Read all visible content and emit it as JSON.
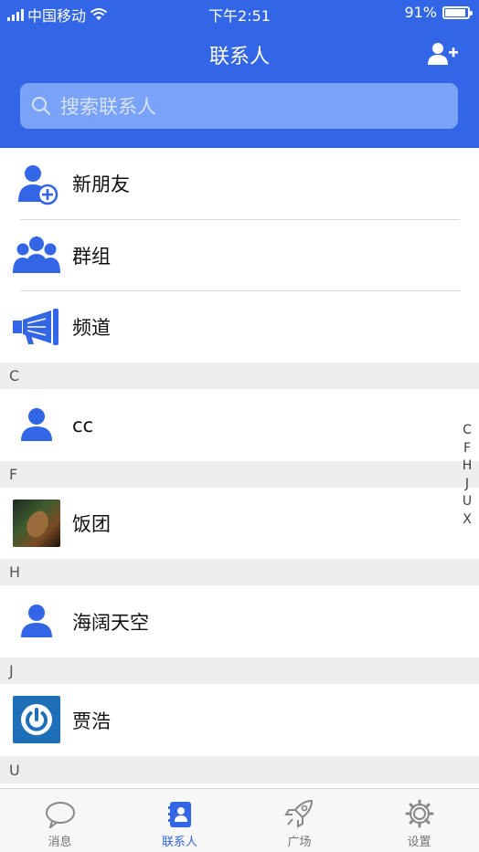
{
  "status_bar": {
    "carrier": "中国移动",
    "time": "下午2:51",
    "battery": "91%"
  },
  "header": {
    "title": "联系人",
    "add_icon": "add-contact-icon"
  },
  "search": {
    "placeholder": "搜索联系人",
    "icon": "search-icon"
  },
  "menu_items": [
    {
      "label": "新朋友",
      "icon": "new-friend-icon"
    },
    {
      "label": "群组",
      "icon": "group-icon"
    },
    {
      "label": "频道",
      "icon": "megaphone-icon"
    }
  ],
  "sections": [
    {
      "letter": "C",
      "contacts": [
        {
          "name": "cc",
          "avatar": "person-icon"
        }
      ]
    },
    {
      "letter": "F",
      "contacts": [
        {
          "name": "饭团",
          "avatar": "photo-avatar"
        }
      ]
    },
    {
      "letter": "H",
      "contacts": [
        {
          "name": "海阔天空",
          "avatar": "person-icon"
        }
      ]
    },
    {
      "letter": "J",
      "contacts": [
        {
          "name": "贾浩",
          "avatar": "power-icon-avatar"
        }
      ]
    },
    {
      "letter": "U",
      "contacts": []
    }
  ],
  "index_letters": [
    "C",
    "F",
    "H",
    "J",
    "U",
    "X"
  ],
  "tab_bar": [
    {
      "label": "消息",
      "icon": "chat-bubble-icon",
      "active": false
    },
    {
      "label": "联系人",
      "icon": "contacts-book-icon",
      "active": true
    },
    {
      "label": "广场",
      "icon": "rocket-icon",
      "active": false
    },
    {
      "label": "设置",
      "icon": "gear-icon",
      "active": false
    }
  ],
  "colors": {
    "primary": "#3366e6",
    "search_bg": "#7aa2f6",
    "section_bg": "#eeeeee",
    "tab_inactive": "#777777"
  }
}
